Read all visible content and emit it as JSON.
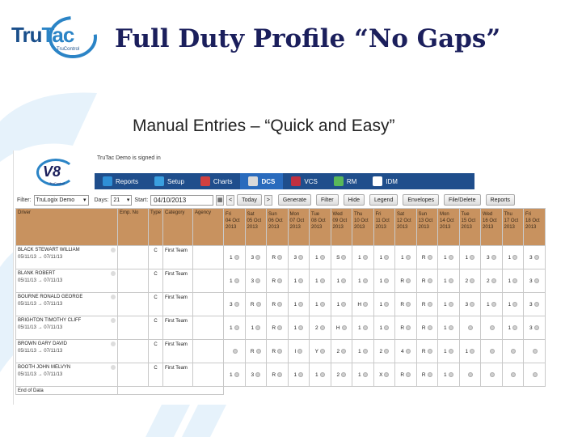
{
  "slide": {
    "logo_text_tru": "Tru",
    "logo_text_tac": "Tac",
    "logo_sub": "TruControl",
    "title": "Full Duty Profile “No Gaps”",
    "subtitle": "Manual Entries – “Quick and Easy”"
  },
  "app": {
    "signed_in": "TruTac Demo is signed in",
    "logo": {
      "text": "V8",
      "sub": "TruControl"
    },
    "menu": [
      {
        "label": "Reports",
        "icon": "reports-icon",
        "color": "#2f8fd6",
        "active": false
      },
      {
        "label": "Setup",
        "icon": "gear-icon",
        "color": "#3aa0e0",
        "active": false
      },
      {
        "label": "Charts",
        "icon": "charts-icon",
        "color": "#d04040",
        "active": false
      },
      {
        "label": "DCS",
        "icon": "dcs-icon",
        "color": "#d9d9d9",
        "active": true
      },
      {
        "label": "VCS",
        "icon": "truck-icon",
        "color": "#c03040",
        "active": false
      },
      {
        "label": "RM",
        "icon": "users-icon",
        "color": "#59b85a",
        "active": false
      },
      {
        "label": "IDM",
        "icon": "document-icon",
        "color": "#ffffff",
        "active": false
      }
    ],
    "toolbar": {
      "filter_label": "Filter:",
      "filter_value": "TruLogix Demo",
      "days_label": "Days:",
      "days_value": "21",
      "start_label": "Start:",
      "start_value": "04/10/2013",
      "prev": "<",
      "today": "Today",
      "next": ">",
      "buttons": [
        "Generate",
        "Filter",
        "Hide",
        "Legend",
        "Envelopes",
        "File/Delete",
        "Reports"
      ]
    },
    "grid": {
      "headers": {
        "driver": "Driver",
        "emp_no": "Emp. No",
        "type": "Type",
        "category": "Category",
        "agency": "Agency"
      },
      "days": [
        {
          "dow": "Fri",
          "date": "04 Oct",
          "year": "2013"
        },
        {
          "dow": "Sat",
          "date": "05 Oct",
          "year": "2013"
        },
        {
          "dow": "Sun",
          "date": "06 Oct",
          "year": "2013"
        },
        {
          "dow": "Mon",
          "date": "07 Oct",
          "year": "2013"
        },
        {
          "dow": "Tue",
          "date": "08 Oct",
          "year": "2013"
        },
        {
          "dow": "Wed",
          "date": "09 Oct",
          "year": "2013"
        },
        {
          "dow": "Thu",
          "date": "10 Oct",
          "year": "2013"
        },
        {
          "dow": "Fri",
          "date": "11 Oct",
          "year": "2013"
        },
        {
          "dow": "Sat",
          "date": "12 Oct",
          "year": "2013"
        },
        {
          "dow": "Sun",
          "date": "13 Oct",
          "year": "2013"
        },
        {
          "dow": "Mon",
          "date": "14 Oct",
          "year": "2013"
        },
        {
          "dow": "Tue",
          "date": "15 Oct",
          "year": "2013"
        },
        {
          "dow": "Wed",
          "date": "16 Oct",
          "year": "2013"
        },
        {
          "dow": "Thu",
          "date": "17 Oct",
          "year": "2013"
        },
        {
          "dow": "Fri",
          "date": "18 Oct",
          "year": "2013"
        }
      ],
      "rows": [
        {
          "name": "BLACK STEWART WILLIAM",
          "dates": "05/11/13 → 07/11/13",
          "type": "C",
          "category": "First Team",
          "values": [
            "1",
            "3",
            "R",
            "3",
            "1",
            "S",
            "1",
            "1",
            "1",
            "R",
            "1",
            "1",
            "3",
            "1",
            "3"
          ]
        },
        {
          "name": "BLANK ROBERT",
          "dates": "05/11/13 → 07/11/13",
          "type": "C",
          "category": "First Team",
          "values": [
            "1",
            "3",
            "R",
            "1",
            "1",
            "1",
            "1",
            "1",
            "R",
            "R",
            "1",
            "2",
            "2",
            "1",
            "3"
          ]
        },
        {
          "name": "BOURNE RONALD GEORGE",
          "dates": "05/11/13 → 07/11/13",
          "type": "C",
          "category": "First Team",
          "values": [
            "3",
            "R",
            "R",
            "1",
            "1",
            "1",
            "H",
            "1",
            "R",
            "R",
            "1",
            "3",
            "1",
            "1",
            "3"
          ]
        },
        {
          "name": "BRIGHTON TIMOTHY CLIFF",
          "dates": "05/11/13 → 07/11/13",
          "type": "C",
          "category": "First Team",
          "values": [
            "1",
            "1",
            "R",
            "1",
            "2",
            "H",
            "1",
            "1",
            "R",
            "R",
            "1",
            "",
            "",
            "1",
            "3"
          ]
        },
        {
          "name": "BROWN GARY DAVID",
          "dates": "05/11/13 → 07/11/13",
          "type": "C",
          "category": "First Team",
          "values": [
            "",
            "R",
            "R",
            "I",
            "Y",
            "2",
            "1",
            "2",
            "4",
            "R",
            "1",
            "1",
            "",
            "",
            ""
          ]
        },
        {
          "name": "BOOTH JOHN MELVYN",
          "dates": "05/11/13 → 07/11/13",
          "type": "C",
          "category": "First Team",
          "values": [
            "1",
            "3",
            "R",
            "1",
            "1",
            "2",
            "1",
            "X",
            "R",
            "R",
            "1",
            "",
            "",
            "",
            ""
          ]
        }
      ],
      "end_label": "End of Data"
    }
  }
}
